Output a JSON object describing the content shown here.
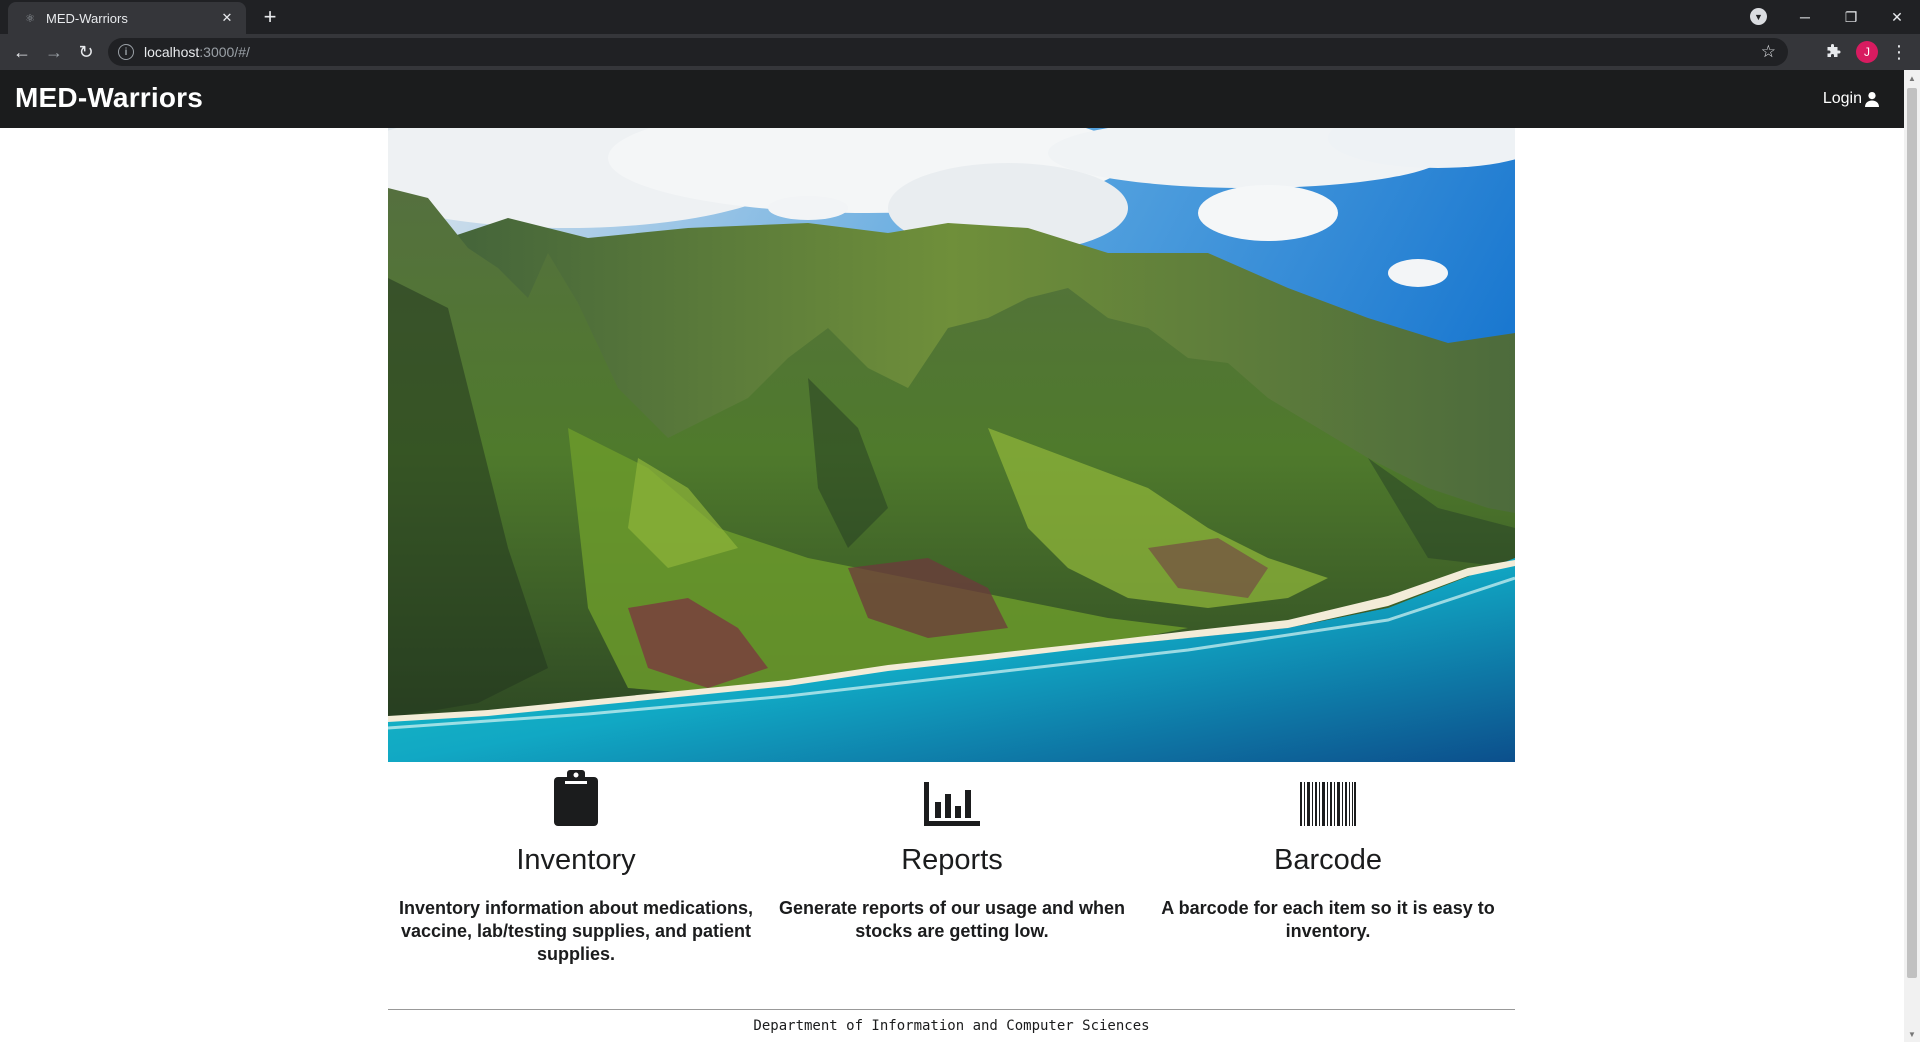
{
  "browser": {
    "tab_title": "MED-Warriors",
    "tab_close": "✕",
    "new_tab": "+",
    "url_host": "localhost",
    "url_rest": ":3000/#/",
    "profile_initial": "J",
    "window_minimize": "─",
    "window_restore": "❐",
    "window_close": "✕"
  },
  "navbar": {
    "brand": "MED-Warriors",
    "login_label": "Login"
  },
  "features": [
    {
      "icon": "clipboard-icon",
      "title": "Inventory",
      "description": "Inventory information about medications, vaccine, lab/testing supplies, and patient supplies."
    },
    {
      "icon": "bar-chart-icon",
      "title": "Reports",
      "description": "Generate reports of our usage and when stocks are getting low."
    },
    {
      "icon": "barcode-icon",
      "title": "Barcode",
      "description": "A barcode for each item so it is easy to inventory."
    }
  ],
  "footer": {
    "text": "Department of Information and Computer Sciences"
  },
  "colors": {
    "navbar_bg": "#1b1c1d",
    "browser_bg": "#202124",
    "toolbar_bg": "#35363a",
    "profile_bg": "#d81b60"
  }
}
